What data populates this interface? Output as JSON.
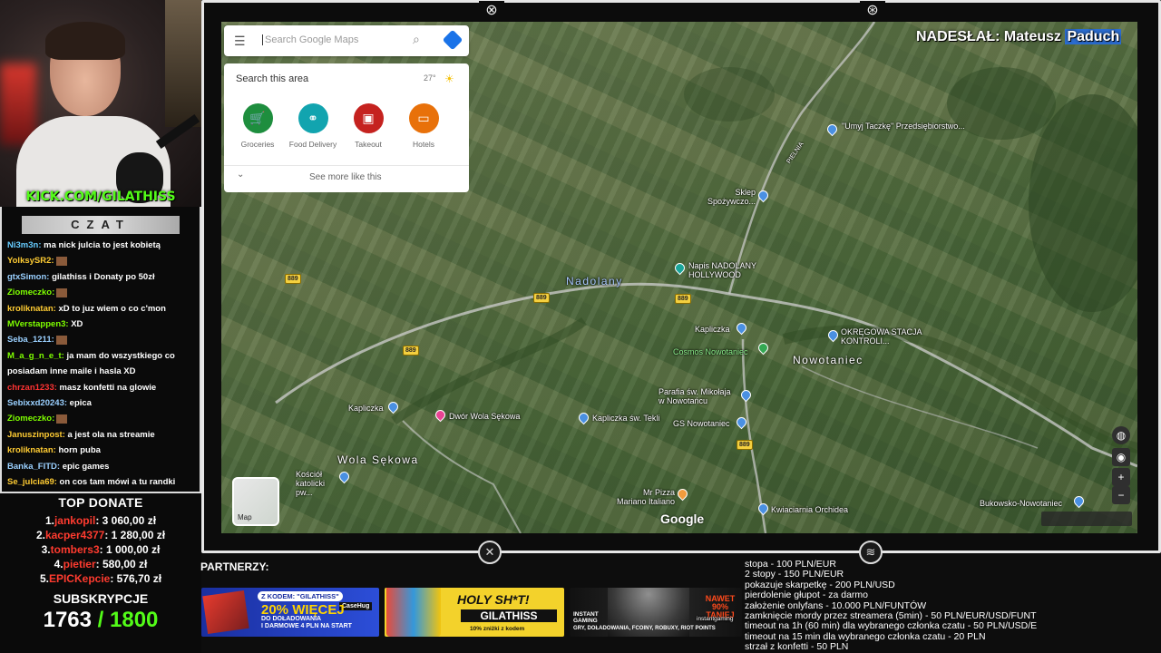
{
  "overlay": {
    "kick_url": "KICK.COM/GILATHISS",
    "chat_title": "CZAT",
    "submitted_by": {
      "prefix": "NADESŁAŁ: Mateusz ",
      "highlight": "Paduch"
    }
  },
  "chat": [
    {
      "user": "Ni3m3n",
      "color": "#66ccff",
      "msg": "ma nick julcia to jest kobietą"
    },
    {
      "user": "YolksySR2",
      "color": "#ffcc33",
      "msg": ""
    },
    {
      "user": "gtxSimon",
      "color": "#9ad0ff",
      "msg": "gilathiss i Donaty po 50zł"
    },
    {
      "user": "Ziomeczko",
      "color": "#7fff00",
      "msg": ""
    },
    {
      "user": "kroliknatan",
      "color": "#ffcc33",
      "msg": "xD to juz wiem o co c'mon"
    },
    {
      "user": "MVerstappen3",
      "color": "#7fff00",
      "msg": "XD"
    },
    {
      "user": "Seba_1211",
      "color": "#9ad0ff",
      "msg": ""
    },
    {
      "user": "M_a_g_n_e_t",
      "color": "#7fff00",
      "msg": "ja mam do wszystkiego co posiadam inne maile i hasla XD"
    },
    {
      "user": "chrzan1233",
      "color": "#ff3333",
      "msg": "masz konfetti na glowie"
    },
    {
      "user": "Sebixxd20243",
      "color": "#9ad0ff",
      "msg": "epica"
    },
    {
      "user": "Ziomeczko",
      "color": "#7fff00",
      "msg": ""
    },
    {
      "user": "Januszinpost",
      "color": "#ffcc33",
      "msg": "a jest ola na streamie"
    },
    {
      "user": "kroliknatan",
      "color": "#ffcc33",
      "msg": "horn puba"
    },
    {
      "user": "Banka_FITD",
      "color": "#9ad0ff",
      "msg": "epic games"
    },
    {
      "user": "Se_julcia69",
      "color": "#ffcc33",
      "msg": "on cos tam mówi a tu randki"
    }
  ],
  "top_donate": {
    "title": "TOP DONATE",
    "donors": [
      {
        "rank": "1.",
        "name": "jankopil",
        "amount": ": 3 060,00 zł"
      },
      {
        "rank": "2.",
        "name": "kacper4377",
        "amount": ": 1 280,00 zł"
      },
      {
        "rank": "3.",
        "name": "tombers3",
        "amount": ": 1 000,00 zł"
      },
      {
        "rank": "4.",
        "name": "pietier",
        "amount": ": 580,00 zł"
      },
      {
        "rank": "5.",
        "name": "EPICKepcie",
        "amount": ": 576,70 zł"
      }
    ]
  },
  "subs": {
    "title": "SUBSKRYPCJE",
    "current": "1763",
    "goal": "/ 1800"
  },
  "maps": {
    "search_placeholder": "Search Google Maps",
    "search_area": "Search this area",
    "temperature": "27°",
    "categories": [
      "Groceries",
      "Food Delivery",
      "Takeout",
      "Hotels"
    ],
    "see_more": "See more like this",
    "map_toggle": "Map",
    "google": "Google",
    "villages": [
      "Nadolany",
      "Nowotaniec",
      "Wola Sękowa"
    ],
    "road": "889",
    "places": [
      "\"Umyj Taczkę\" Przedsiębiorstwo...",
      "Sklep Spożywczo...",
      "Napis NADOLANY HOLLYWOOD",
      "Kapliczka",
      "Cosmos Nowotaniec",
      "OKRĘGOWA STACJA KONTROLI...",
      "Parafia św. Mikołaja w Nowotańcu",
      "Kapliczka",
      "Dwór Wola Sękowa",
      "Kapliczka św. Tekli",
      "GS Nowotaniec",
      "Kościół katolicki pw...",
      "Mr Pizza Mariano Italiano",
      "Kwiaciarnia Orchidea",
      "Bukowsko-Nowotaniec"
    ],
    "street": "PIELNIA"
  },
  "partners": {
    "label": "PARTNERZY:",
    "banner1": {
      "code": "Z KODEM: \"GILATHISS\"",
      "pct": "20% WIĘCEJ",
      "l1": "DO DOŁADOWANIA",
      "l2": "I DARMOWE 4 PLN NA START",
      "brand": "CaseHug"
    },
    "banner2": {
      "title": "HOLY SH*T!",
      "name": "GILATHISS",
      "sub": "10% zniżki z kodem"
    },
    "banner3": {
      "brand": "INSTANT GAMING",
      "now": "NAWET 90% TANIEJ",
      "site": "instantgaming",
      "sub": "GRY, DOŁADOWANIA, FCOINY, ROBUXY, RIOT POINTS"
    }
  },
  "rules": [
    "stopa - 100 PLN/EUR",
    "2 stopy - 150 PLN/EUR",
    "pokazuje skarpetkę - 200 PLN/USD",
    "pierdolenie głupot - za darmo",
    "założenie onlyfans - 10.000 PLN/FUNTÓW",
    "zamknięcie mordy przez streamera (5min) - 50 PLN/EUR/USD/FUNT",
    "timeout na 1h (60 min) dla wybranego członka czatu - 50 PLN/USD/E",
    "timeout na 15 min dla wybranego członka czatu - 20 PLN",
    "strzał z konfetti - 50 PLN"
  ],
  "colors": {
    "kick_green": "#53fc18",
    "donor_red": "#ff3b2f",
    "maps_blue": "#1a73e8"
  }
}
